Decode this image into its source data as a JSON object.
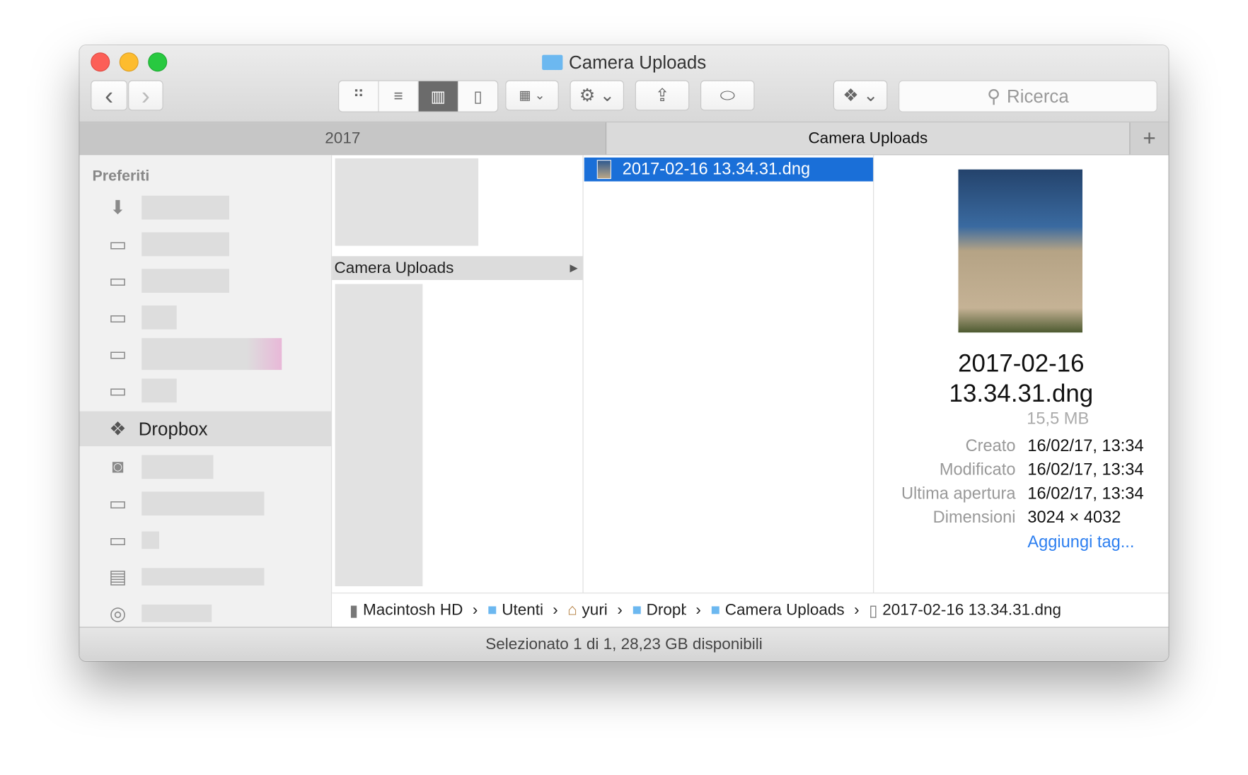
{
  "window": {
    "title": "Camera Uploads"
  },
  "toolbar": {
    "back": "‹",
    "forward": "›",
    "search_placeholder": "Ricerca"
  },
  "tabs": [
    {
      "label": "2017"
    },
    {
      "label": "Camera Uploads"
    }
  ],
  "tab_add": "+",
  "sidebar": {
    "section": "Preferiti",
    "dropbox": "Dropbox"
  },
  "column1": {
    "selected": "Camera Uploads"
  },
  "column2": {
    "selected": "2017-02-16 13.34.31.dng"
  },
  "info": {
    "name_line1": "2017-02-16",
    "name_line2": "13.34.31.dng",
    "size": "15,5 MB",
    "rows": [
      {
        "k": "Creato",
        "v": "16/02/17, 13:34"
      },
      {
        "k": "Modificato",
        "v": "16/02/17, 13:34"
      },
      {
        "k": "Ultima apertura",
        "v": "16/02/17, 13:34"
      },
      {
        "k": "Dimensioni",
        "v": "3024 × 4032"
      }
    ],
    "add_tags": "Aggiungi tag..."
  },
  "path": [
    "Macintosh HD",
    "Utenti",
    "yuri",
    "Dropbox",
    "Camera Uploads",
    "2017-02-16 13.34.31.dng"
  ],
  "status": "Selezionato 1 di 1, 28,23 GB disponibili"
}
